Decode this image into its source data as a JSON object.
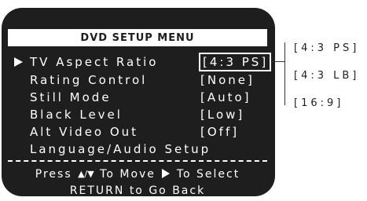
{
  "menu": {
    "title": "DVD SETUP MENU",
    "items": [
      {
        "label": "TV Aspect Ratio",
        "value": "[4:3 PS]",
        "selected": true
      },
      {
        "label": "Rating Control",
        "value": "[None]",
        "selected": false
      },
      {
        "label": "Still Mode",
        "value": "[Auto]",
        "selected": false
      },
      {
        "label": "Black Level",
        "value": "[Low]",
        "selected": false
      },
      {
        "label": "Alt Video Out",
        "value": "[Off]",
        "selected": false
      },
      {
        "label": "Language/Audio Setup",
        "value": "",
        "selected": false
      }
    ],
    "cursor_icon": "right-triangle-icon"
  },
  "footer": {
    "press": "Press",
    "up_down_icon": "▲/▼",
    "to_move": "To Move",
    "select_icon": "right-triangle-icon",
    "to_select": "To Select",
    "return_text": "RETURN to Go Back"
  },
  "options": [
    "[4:3 PS]",
    "[4:3 LB]",
    "[16:9]"
  ],
  "colors": {
    "panel": "#1e1e1e",
    "text": "#ffffff",
    "page": "#ffffff"
  }
}
